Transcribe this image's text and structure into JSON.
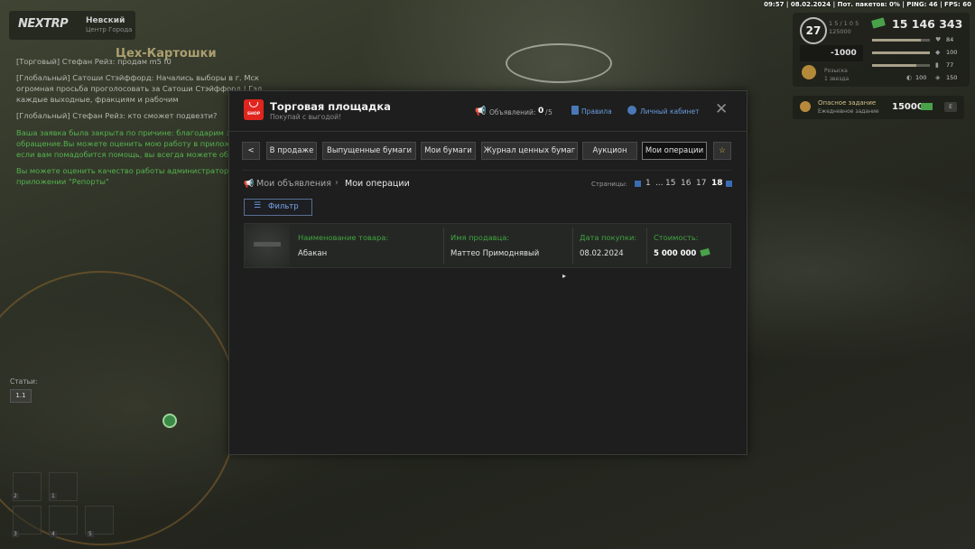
{
  "status_line": "09:57 | 08.02.2024 | Пот. пакетов: 0% | PING: 46 | FPS: 60",
  "logo": {
    "text": "NEXTRP",
    "server": "Невский",
    "server_sub": "Центр Города"
  },
  "area_title": "Цех-Картошки",
  "chat": [
    {
      "text": "[Торговый] Стефан Рейз: продам m5 f0",
      "color": "gray"
    },
    {
      "text": "[Глобальный] Сатоши Стэйффорд: Начались выборы в г. Мск",
      "color": "gray"
    },
    {
      "text": "огромная просьба проголосовать за Сатоши Стэйффорд | Гэлка",
      "color": "gray"
    },
    {
      "text": "каждые выходные, фракциям и рабочим",
      "color": "gray"
    },
    {
      "text": "[Глобальный] Стефан Рейз: кто сможет подвезти?",
      "color": "gray"
    },
    {
      "text": "Ваша заявка была закрыта по причине: благодарим за",
      "color": "green"
    },
    {
      "text": "обращение.Вы можете оценить мою работу в приложении",
      "color": "green"
    },
    {
      "text": "если вам помадобится помощь, вы всегда можете обратиться",
      "color": "green"
    },
    {
      "text": "Вы можете оценить качество работы администратора в",
      "color": "green"
    },
    {
      "text": "приложении \"Репорты\"",
      "color": "green"
    }
  ],
  "hud": {
    "level": "27",
    "xp": "1 5 / 1 0 5",
    "xp2": "125000",
    "money": "15 146 343",
    "debt": "-1000",
    "stats": {
      "health": "84",
      "armor": "100",
      "hunger": "77",
      "thirst": "100",
      "water": "150"
    },
    "stats_fill": {
      "health": 0.84,
      "armor": 1.0,
      "hunger": 0.77
    },
    "wanted_1": "Розыска",
    "wanted_2": "1 звезда"
  },
  "task": {
    "title": "Опасное задание",
    "subtitle": "Ежедневное задание",
    "amount": "15000",
    "button": "Е"
  },
  "stats_block": {
    "label": "Статьи:",
    "value": "1.1"
  },
  "slots": [
    "2",
    "1",
    "3",
    "4",
    "5"
  ],
  "modal": {
    "title": "Торговая площадка",
    "subtitle": "Покупай с выгодой!",
    "logo_text": "SHOP",
    "ads_label": "Объявлений:",
    "ads_current": "0",
    "ads_max": "5",
    "rules": "Правила",
    "cabinet": "Личный кабинет",
    "close": "✕",
    "tabs": [
      {
        "label": "<"
      },
      {
        "label": "В продаже"
      },
      {
        "label": "Выпущенные бумаги"
      },
      {
        "label": "Мои бумаги"
      },
      {
        "label": "Журнал ценных бумаг"
      },
      {
        "label": "Аукцион"
      },
      {
        "label": "Мои операции"
      },
      {
        "label": "☆"
      }
    ],
    "breadcrumb": [
      "Мои объявления",
      "Мои операции"
    ],
    "pages_label": "Страницы:",
    "pages": [
      "1",
      "...",
      "15",
      "16",
      "17",
      "18"
    ],
    "filter": "Фильтр",
    "columns": [
      "Наименование товара:",
      "Имя продавца:",
      "Дата покупки:",
      "Стоимость:"
    ],
    "rows": [
      {
        "item": "Абакан",
        "seller": "Маттео Примоднявый",
        "date": "08.02.2024",
        "price": "5 000 000"
      }
    ]
  }
}
